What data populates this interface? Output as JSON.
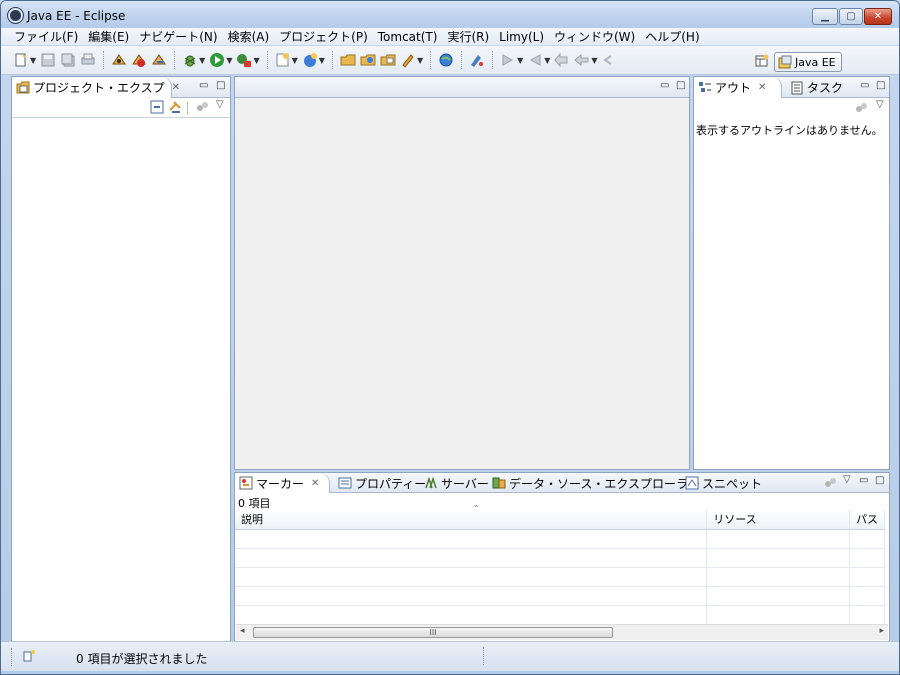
{
  "window": {
    "title": "Java EE - Eclipse"
  },
  "menu": [
    "ファイル(F)",
    "編集(E)",
    "ナビゲート(N)",
    "検索(A)",
    "プロジェクト(P)",
    "Tomcat(T)",
    "実行(R)",
    "Limy(L)",
    "ウィンドウ(W)",
    "ヘルプ(H)"
  ],
  "toolbar": {
    "perspective_label": "Java EE"
  },
  "project_explorer": {
    "tab_label": "プロジェクト・エクスプ"
  },
  "outline": {
    "tab_label": "アウト",
    "tasks_tab_label": "タスク",
    "empty_message": "表示するアウトラインはありません。"
  },
  "bottom_panel": {
    "tabs": [
      "マーカー",
      "プロパティー",
      "サーバー",
      "データ・ソース・エクスプローラー",
      "スニペット"
    ],
    "item_count": "0 項目",
    "columns": [
      "説明",
      "リソース",
      "パス"
    ],
    "scroll_thumb_grip": "III"
  },
  "status_bar": {
    "message": "0 項目が選択されました"
  }
}
